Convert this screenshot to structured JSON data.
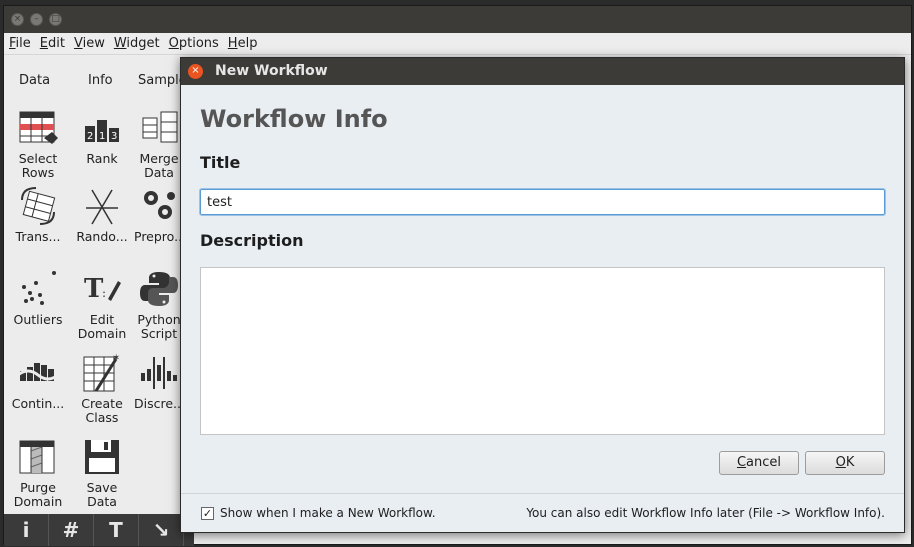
{
  "menubar": {
    "items": [
      {
        "pre": "",
        "u": "F",
        "post": "ile"
      },
      {
        "pre": "",
        "u": "E",
        "post": "dit"
      },
      {
        "pre": "",
        "u": "V",
        "post": "iew"
      },
      {
        "pre": "",
        "u": "W",
        "post": "idget"
      },
      {
        "pre": "",
        "u": "O",
        "post": "ptions"
      },
      {
        "pre": "",
        "u": "H",
        "post": "elp"
      }
    ]
  },
  "widget_panel": {
    "categories": [
      "Data",
      "Info",
      "Sample"
    ],
    "widgets": [
      {
        "label": "Select\nRows",
        "icon": "select-rows-icon"
      },
      {
        "label": "Rank",
        "icon": "rank-icon"
      },
      {
        "label": "Merge\nData",
        "icon": "merge-data-icon"
      },
      {
        "label": "Trans...",
        "icon": "transpose-icon"
      },
      {
        "label": "Rando...",
        "icon": "randomize-icon"
      },
      {
        "label": "Prepro...",
        "icon": "preprocess-icon"
      },
      {
        "label": "Outliers",
        "icon": "outliers-icon"
      },
      {
        "label": "Edit\nDomain",
        "icon": "edit-domain-icon"
      },
      {
        "label": "Python\nScript",
        "icon": "python-script-icon"
      },
      {
        "label": "Contin...",
        "icon": "continuize-icon"
      },
      {
        "label": "Create\nClass",
        "icon": "create-class-icon"
      },
      {
        "label": "Discre...",
        "icon": "discretize-icon"
      },
      {
        "label": "Purge\nDomain",
        "icon": "purge-domain-icon"
      },
      {
        "label": "Save\nData",
        "icon": "save-data-icon"
      }
    ],
    "rank_digits": "2 1 3"
  },
  "bottom_toolbar": {
    "buttons": [
      {
        "glyph": "i",
        "icon": "info-icon"
      },
      {
        "glyph": "#",
        "icon": "grid-icon"
      },
      {
        "glyph": "T",
        "icon": "text-annotation-icon"
      },
      {
        "glyph": "↘",
        "icon": "arrow-annotation-icon"
      }
    ]
  },
  "dialog": {
    "title": "New Workflow",
    "heading": "Workflow Info",
    "title_label": "Title",
    "title_value": "test",
    "description_label": "Description",
    "description_value": "",
    "cancel": {
      "pre": "",
      "u": "C",
      "post": "ancel"
    },
    "ok": {
      "pre": "",
      "u": "O",
      "post": "K"
    },
    "show_checkbox_checked": true,
    "show_checkbox_label": "Show when I make a New Workflow.",
    "footer_hint": "You can also edit Workflow Info later (File -> Workflow Info)."
  }
}
